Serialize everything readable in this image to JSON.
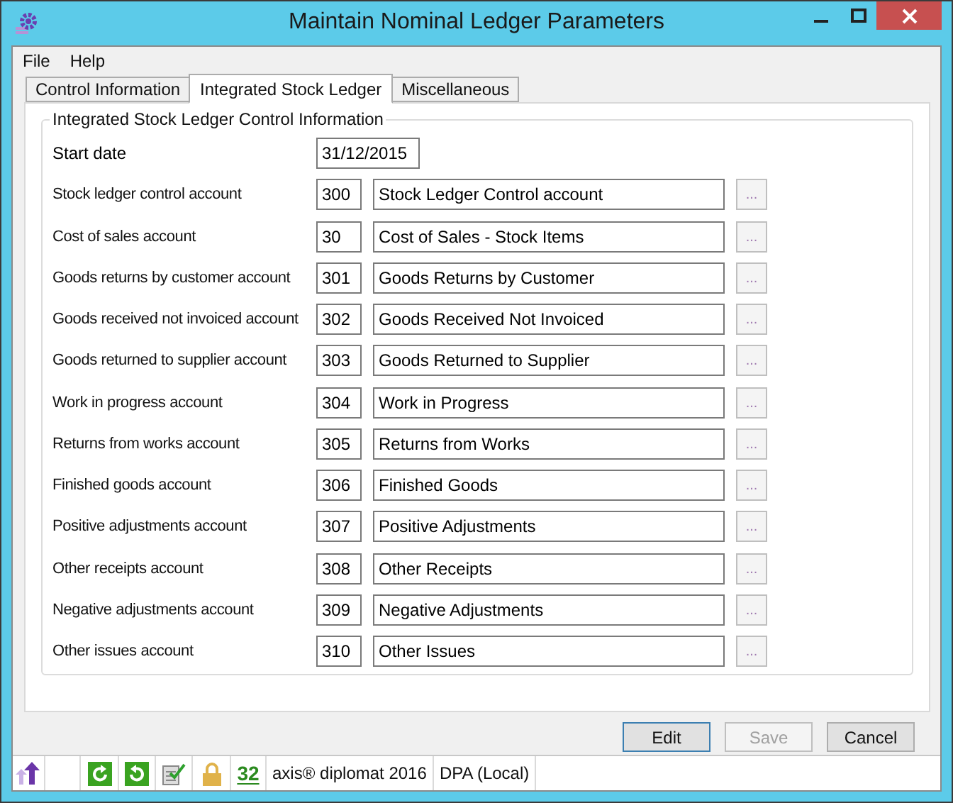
{
  "window": {
    "title": "Maintain Nominal Ledger Parameters"
  },
  "menu": [
    "File",
    "Help"
  ],
  "tabs": [
    {
      "label": "Control Information",
      "selected": false
    },
    {
      "label": "Integrated Stock Ledger",
      "selected": true
    },
    {
      "label": "Miscellaneous",
      "selected": false
    }
  ],
  "group": {
    "title": "Integrated Stock Ledger Control Information",
    "start_date": {
      "label": "Start date",
      "value": "31/12/2015"
    },
    "accounts": [
      {
        "label": "Stock ledger control account",
        "code": "300",
        "name": "Stock Ledger Control account",
        "browse": {
          "label": "...",
          "disabled": true
        }
      },
      {
        "label": "Cost of sales account",
        "code": "30",
        "name": "Cost of Sales - Stock Items",
        "browse": {
          "label": "...",
          "disabled": true
        }
      },
      {
        "label": "Goods returns by customer account",
        "code": "301",
        "name": "Goods Returns by Customer",
        "browse": {
          "label": "...",
          "disabled": true
        }
      },
      {
        "label": "Goods received not invoiced account",
        "code": "302",
        "name": "Goods Received Not Invoiced",
        "browse": {
          "label": "...",
          "disabled": true
        }
      },
      {
        "label": "Goods returned to supplier account",
        "code": "303",
        "name": "Goods Returned to Supplier",
        "browse": {
          "label": "...",
          "disabled": true
        }
      },
      {
        "label": "Work in progress account",
        "code": "304",
        "name": "Work in Progress",
        "browse": {
          "label": "...",
          "disabled": true
        }
      },
      {
        "label": "Returns from works account",
        "code": "305",
        "name": "Returns from Works",
        "browse": {
          "label": "...",
          "disabled": true
        }
      },
      {
        "label": "Finished goods account",
        "code": "306",
        "name": "Finished Goods",
        "browse": {
          "label": "...",
          "disabled": true
        }
      },
      {
        "label": "Positive adjustments account",
        "code": "307",
        "name": "Positive Adjustments",
        "browse": {
          "label": "...",
          "disabled": true
        }
      },
      {
        "label": "Other receipts account",
        "code": "308",
        "name": "Other Receipts",
        "browse": {
          "label": "...",
          "disabled": true
        }
      },
      {
        "label": "Negative adjustments account",
        "code": "309",
        "name": "Negative Adjustments",
        "browse": {
          "label": "...",
          "disabled": true
        }
      },
      {
        "label": "Other issues account",
        "code": "310",
        "name": "Other Issues",
        "browse": {
          "label": "...",
          "disabled": true
        }
      }
    ]
  },
  "buttons": [
    {
      "label": "Edit",
      "disabled": false
    },
    {
      "label": "Save",
      "disabled": true
    },
    {
      "label": "Cancel",
      "disabled": false
    }
  ],
  "status_bar": {
    "count": "32",
    "product": "axis® diplomat 2016",
    "database": "DPA (Local)"
  }
}
